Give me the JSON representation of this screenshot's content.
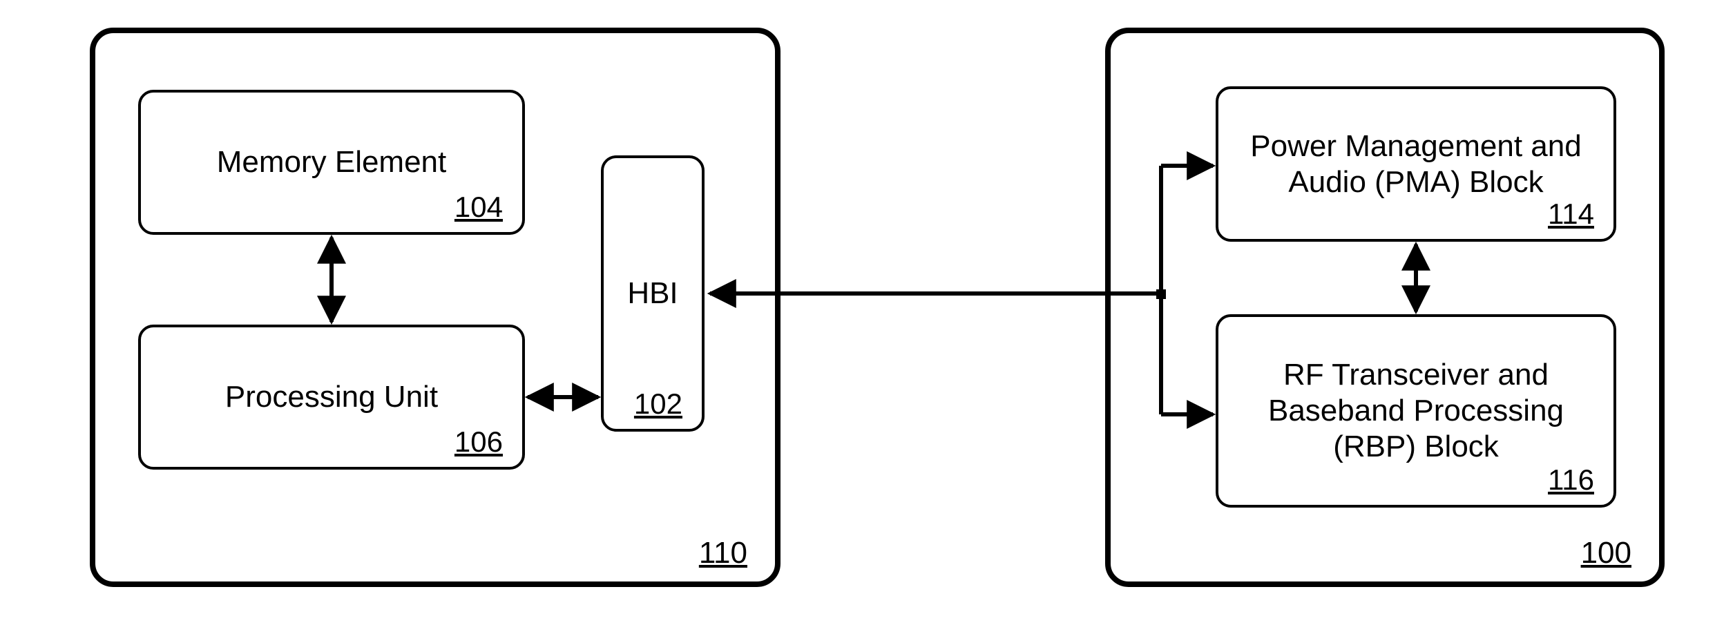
{
  "left_block": {
    "ref": "110",
    "memory": {
      "label": "Memory Element",
      "ref": "104"
    },
    "processing": {
      "label": "Processing Unit",
      "ref": "106"
    },
    "hbi": {
      "label": "HBI",
      "ref": "102"
    }
  },
  "right_block": {
    "ref": "100",
    "pma": {
      "label": "Power Management and\nAudio (PMA) Block",
      "ref": "114"
    },
    "rbp": {
      "label": "RF Transceiver and\nBaseband Processing\n(RBP) Block",
      "ref": "116"
    }
  }
}
